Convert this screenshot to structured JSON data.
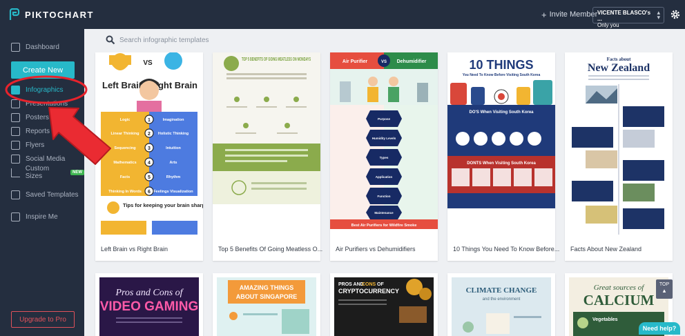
{
  "app": {
    "brand": "PIKTOCHART"
  },
  "header": {
    "invite_label": "Invite Member",
    "user_name": "VICENTE BLASCO's ...",
    "user_scope": "Only you"
  },
  "sidebar": {
    "dashboard": "Dashboard",
    "create_new": "Create New",
    "items": [
      {
        "label": "Infographics",
        "icon": "infographic-icon"
      },
      {
        "label": "Presentations",
        "icon": "presentation-icon"
      },
      {
        "label": "Posters",
        "icon": "poster-icon"
      },
      {
        "label": "Reports",
        "icon": "report-icon"
      },
      {
        "label": "Flyers",
        "icon": "flyer-icon"
      },
      {
        "label": "Social Media",
        "icon": "social-media-icon"
      },
      {
        "label": "Custom Sizes",
        "icon": "custom-size-icon",
        "badge": "NEW"
      }
    ],
    "saved_templates": "Saved Templates",
    "inspire_me": "Inspire Me",
    "upgrade": "Upgrade to Pro"
  },
  "search": {
    "placeholder": "Search infographic templates"
  },
  "templates": [
    {
      "title": "Left Brain vs Right Brain",
      "thumb": {
        "left": "Left Brain",
        "vs": "VS",
        "right": "Right Brain",
        "rows": [
          [
            "Logic",
            "1",
            "Imagination"
          ],
          [
            "Linear Thinking",
            "2",
            "Holistic Thinking"
          ],
          [
            "Sequencing",
            "3",
            "Intuition"
          ],
          [
            "Mathematics",
            "4",
            "Arts"
          ],
          [
            "Facts",
            "5",
            "Rhythm"
          ],
          [
            "Thinking In Words",
            "6",
            "Feelings Visualization"
          ]
        ],
        "tips": "Tips for keeping your brain sharp"
      }
    },
    {
      "title": "Top 5 Benefits Of Going Meatless O...",
      "thumb": {
        "heading": "TOP 5 BENEFITS OF GOING MEATLESS ON MONDAYS"
      }
    },
    {
      "title": "Air Purifiers vs Dehumidifiers",
      "thumb": {
        "left": "Air Purifier",
        "vs": "VS",
        "right": "Dehumidifier",
        "rows": [
          "Purpose",
          "Humidity Levels",
          "Types",
          "Application",
          "Function",
          "Maintenance"
        ],
        "footer": "Best Air Purifiers for Wildfire Smoke"
      }
    },
    {
      "title": "10 Things You Need To Know Before...",
      "thumb": {
        "heading": "10 THINGS",
        "sub": "You Need To Know Before Visiting South Korea",
        "dos": "DO'S When Visiting South Korea",
        "donts": "DONTS When Visiting South Korea"
      }
    },
    {
      "title": "Facts About New Zealand",
      "thumb": {
        "pre": "Facts about",
        "heading": "New Zealand"
      }
    },
    {
      "title": "",
      "thumb": {
        "line1": "Pros and Cons of",
        "line2": "VIDEO GAMING"
      }
    },
    {
      "title": "",
      "thumb": {
        "line1": "AMAZING THINGS",
        "line2": "ABOUT SINGAPORE"
      }
    },
    {
      "title": "",
      "thumb": {
        "line1a": "PROS AND",
        "line1b": "CONS",
        "line1c": "OF",
        "line2": "CRYPTOCURRENCY"
      }
    },
    {
      "title": "",
      "thumb": {
        "line1": "CLIMATE CHANGE",
        "line2": "and the environment"
      }
    },
    {
      "title": "",
      "thumb": {
        "line1": "Great sources of",
        "line2": "CALCIUM",
        "tag": "Vegetables"
      }
    }
  ],
  "floating": {
    "top": "TOP",
    "help": "Need help?"
  },
  "colors": {
    "sidebar_bg": "#242e3f",
    "accent": "#27b9c9",
    "upgrade": "#e0525b",
    "annotation": "#e8232c"
  }
}
